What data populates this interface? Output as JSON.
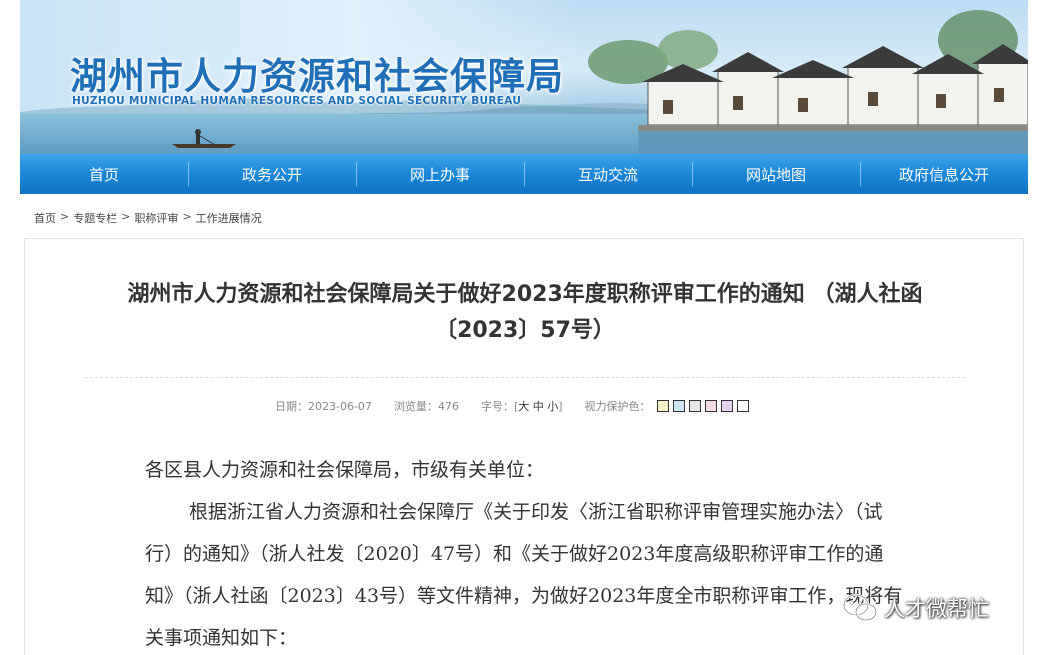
{
  "header": {
    "title": "湖州市人力资源和社会保障局",
    "subtitle": "HUZHOU MUNICIPAL HUMAN RESOURCES AND SOCIAL SECURITY BUREAU"
  },
  "nav": {
    "items": [
      {
        "label": "首页"
      },
      {
        "label": "政务公开"
      },
      {
        "label": "网上办事"
      },
      {
        "label": "互动交流"
      },
      {
        "label": "网站地图"
      },
      {
        "label": "政府信息公开"
      }
    ]
  },
  "breadcrumb": {
    "items": [
      "首页",
      "专题专栏",
      "职称评审",
      "工作进展情况"
    ],
    "separator": ">"
  },
  "article": {
    "title_line1": "湖州市人力资源和社会保障局关于做好2023年度职称评审工作的通知 （湖人社函",
    "title_line2": "〔2023〕57号）",
    "meta": {
      "date_label": "日期：",
      "date": "2023-06-07",
      "views_label": "浏览量：",
      "views": "476",
      "font_label": "字号：",
      "font_open": "[",
      "font_large": "大",
      "font_medium": "中",
      "font_small": "小",
      "font_close": "]",
      "eye_label": "视力保护色："
    },
    "swatch_colors": [
      "#f8f4c8",
      "#cfe6f5",
      "#e6e6e6",
      "#f5dde6",
      "#e6d2ef",
      "#ffffff"
    ],
    "paragraphs": [
      "各区县人力资源和社会保障局，市级有关单位：",
      "根据浙江省人力资源和社会保障厅《关于印发〈浙江省职称评审管理实施办法〉（试行）的通知》（浙人社发〔2020〕47号）和《关于做好2023年度高级职称评审工作的通知》（浙人社函〔2023〕43号）等文件精神，为做好2023年度全市职称评审工作，现将有关事项通知如下："
    ]
  },
  "watermark": {
    "text": "人才微帮忙",
    "icon": "wechat-icon"
  },
  "colors": {
    "nav_bg": "#1b86d8",
    "title_blue": "#1f6fb8"
  }
}
